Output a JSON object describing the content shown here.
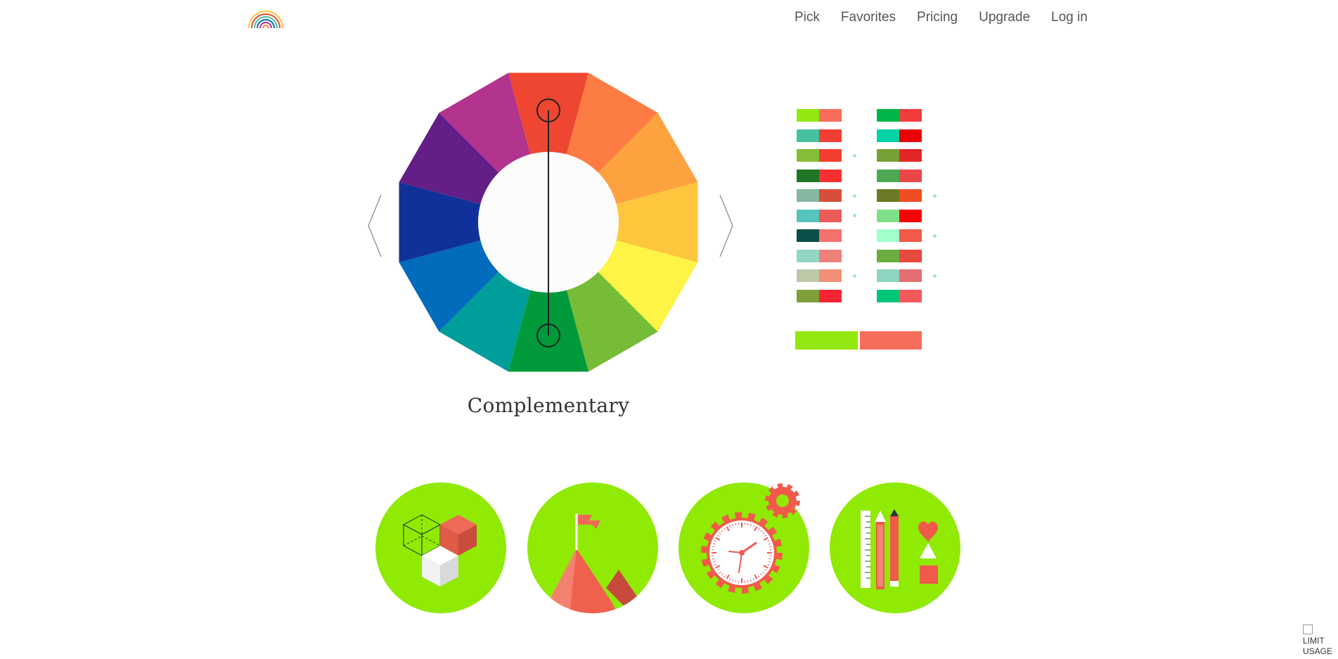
{
  "nav": {
    "items": [
      "Pick",
      "Favorites",
      "Pricing",
      "Upgrade",
      "Log in"
    ]
  },
  "wheel": {
    "scheme_name": "Complementary",
    "segment_colors": [
      "#ef4631",
      "#fd7c43",
      "#fea240",
      "#fec63c",
      "#fef446",
      "#76bc36",
      "#009a3a",
      "#009e9a",
      "#016bbc",
      "#11319a",
      "#631e87",
      "#b2348f"
    ],
    "selected_hues": [
      "red",
      "green"
    ]
  },
  "palettes": {
    "left": [
      [
        "#93e80f",
        "#f76d5b"
      ],
      [
        "#45c1a0",
        "#f13d32"
      ],
      [
        "#84be36",
        "#f33d2f"
      ],
      [
        "#207624",
        "#f63030"
      ],
      [
        "#86b7a0",
        "#d94e3a"
      ],
      [
        "#57c3bd",
        "#ea5b59"
      ],
      [
        "#0c4f48",
        "#f4716d"
      ],
      [
        "#92d7c4",
        "#ee7f7b"
      ],
      [
        "#bcc9a9",
        "#f18f77"
      ],
      [
        "#7ea03b",
        "#f62531"
      ]
    ],
    "right": [
      [
        "#00b547",
        "#f23d3e"
      ],
      [
        "#00d3a5",
        "#ec0006"
      ],
      [
        "#77a035",
        "#e32727"
      ],
      [
        "#4daa54",
        "#ea4848"
      ],
      [
        "#6b7b24",
        "#f14d22"
      ],
      [
        "#7fdf88",
        "#f70005"
      ],
      [
        "#a0ffcb",
        "#f15a46"
      ],
      [
        "#68ad3d",
        "#e54a3d"
      ],
      [
        "#8fd3c1",
        "#e56e73"
      ],
      [
        "#00c577",
        "#f4595a"
      ]
    ],
    "left_dots": [
      2,
      4,
      5,
      8
    ],
    "right_dots": [
      4,
      6,
      8
    ],
    "selected": [
      "#93e80f",
      "#f76d5b"
    ]
  },
  "features": {
    "icons": [
      "cubes-icon",
      "mountain-flag-icon",
      "clock-gear-icon",
      "design-tools-icon"
    ]
  },
  "limit_badge": {
    "alt_text": "LIMIT USAGE"
  }
}
